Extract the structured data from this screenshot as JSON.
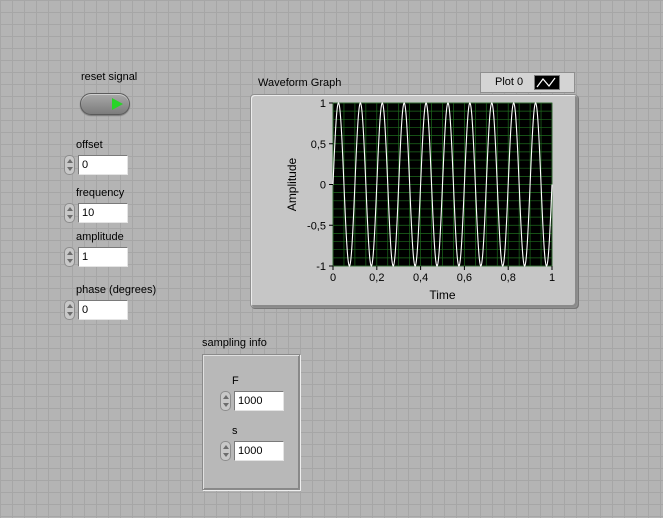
{
  "controls": {
    "reset_signal": {
      "label": "reset signal"
    },
    "offset": {
      "label": "offset",
      "value": "0"
    },
    "frequency": {
      "label": "frequency",
      "value": "10"
    },
    "amplitude": {
      "label": "amplitude",
      "value": "1"
    },
    "phase": {
      "label": "phase (degrees)",
      "value": "0"
    }
  },
  "graph": {
    "title": "Waveform Graph",
    "legend_label": "Plot 0"
  },
  "sampling": {
    "title": "sampling info",
    "f_label": "F",
    "f_value": "1000",
    "s_label": "s",
    "s_value": "1000"
  },
  "chart_data": {
    "type": "line",
    "title": "Waveform Graph",
    "xlabel": "Time",
    "ylabel": "Amplitude",
    "xlim": [
      0,
      1
    ],
    "ylim": [
      -1,
      1
    ],
    "x_ticks": [
      "0",
      "0,2",
      "0,4",
      "0,6",
      "0,8",
      "1"
    ],
    "y_ticks": [
      "1",
      "0,5",
      "0",
      "-0,5",
      "-1"
    ],
    "grid": true,
    "background": "#000000",
    "grid_color": "#1e6a1e",
    "series": [
      {
        "name": "Plot 0",
        "function": "sine",
        "frequency": 10,
        "amplitude": 1,
        "offset": 0,
        "phase_degrees": 0,
        "samples": 1000,
        "color": "#ffffff"
      }
    ]
  }
}
